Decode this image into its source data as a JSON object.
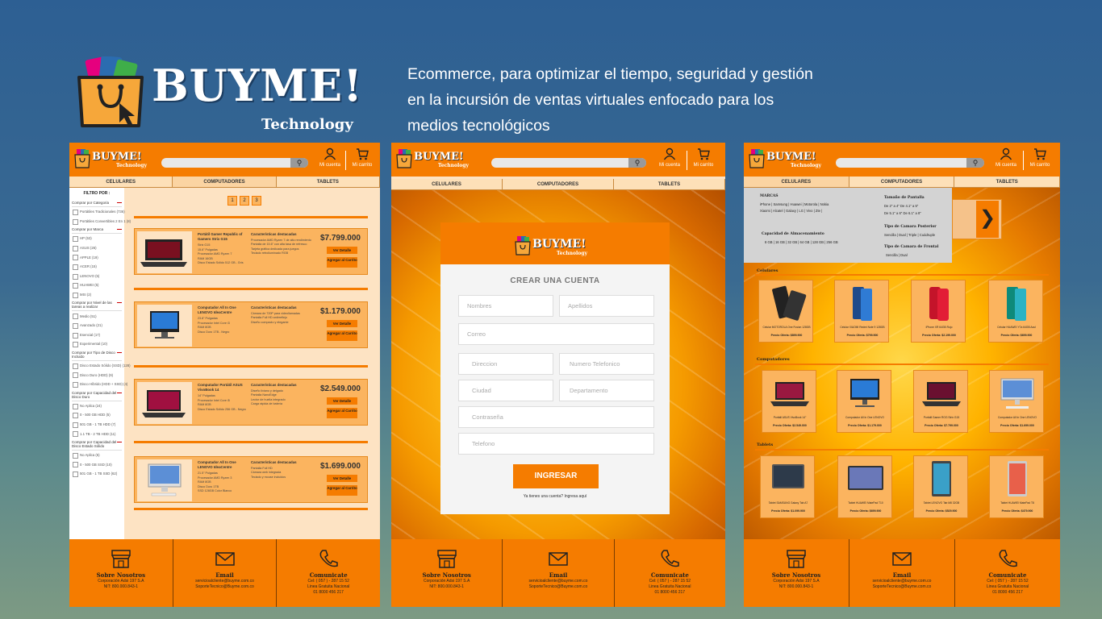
{
  "brand": {
    "title": "BUYME!",
    "subtitle": "Technology",
    "tagline": [
      "Ecommerce, para optimizar el tiempo, seguridad y gestión",
      "en la incursión de ventas virtuales enfocado para los",
      "medios tecnológicos"
    ]
  },
  "header": {
    "logo": "BUYME!",
    "logo_sub": "Technology",
    "account": "Mi cuenta",
    "cart": "Mi carrito"
  },
  "tabs": [
    "CELULARES",
    "COMPUTADORES",
    "TABLETS"
  ],
  "footer": {
    "about": {
      "title": "Sobre Nosotros",
      "lines": [
        "Corporación Adsi 197 S.A",
        "NIT: 800.000.843-1"
      ]
    },
    "email": {
      "title": "Email",
      "lines": [
        "servicioalcliente@buyme.com.co",
        "SoporteTecnico@Buyme.com.co"
      ]
    },
    "contact": {
      "title": "Comunicate",
      "lines": [
        "Cel: ( 057 ) - 287 15 52",
        "Linea Gratuita Nacional",
        "01 8000 456 217"
      ]
    }
  },
  "panel1": {
    "filter_title": "FILTRO POR :",
    "filters": [
      {
        "group": "Comprar por Categoria",
        "options": [
          "Portátiles Tradicionales (736)",
          "Portátiles Convertibles 2 En 1 (8)"
        ]
      },
      {
        "group": "Comprar por Marca",
        "options": [
          "HP (53)",
          "ASUS (26)",
          "APPLE (19)",
          "ACER (15)",
          "LENOVO (5)",
          "HUAWEI (5)",
          "MSI (2)"
        ]
      },
      {
        "group": "Comprar por Nivel de las tareas a realizar",
        "options": [
          "Medio (51)",
          "Avanzado (21)",
          "Esencial (17)",
          "Experimental (10)"
        ]
      },
      {
        "group": "Comprar por Tipo de Disco Incluido",
        "options": [
          "Disco Estado Sólido (SSD) (128)",
          "Disco Duro (HDD) (9)",
          "Disco Híbrido (HDD + SSD) (4)"
        ]
      },
      {
        "group": "Comprar por Capacidad del Disco Duro",
        "options": [
          "No Aplica (24)",
          "0 - 500 GB HDD (5)",
          "501 GB - 1 TB HDD (7)",
          "1.1 TB - 2 TB HDD (11)"
        ]
      },
      {
        "group": "Comprar por Capacidad del Disco Estado Sólido",
        "options": [
          "No Aplica (5)",
          "0 - 500 GB SSD (10)",
          "501 GB - 1 TB SSD (62)"
        ]
      }
    ],
    "pages": [
      "1",
      "2",
      "3"
    ],
    "products": [
      {
        "name": "Portátil Gamer Republic of Gamers Strix G15",
        "specs": [
          "Computador Portátil ROG",
          "Strix G15",
          "15.6\" Pulgadas",
          "Procesador AMD Ryzen 7",
          "RAM 16GB",
          "Disco Estado Sólido 512 GB - Gris"
        ],
        "chars_title": "Características destacadas",
        "chars": [
          "Procesador AMD Ryzen 7 de alto rendimiento",
          "Pantalla de 15.6\" con alta tasa de refresco",
          "Tarjeta gráfica dedicada para juegos",
          "Teclado retroiluminado RGB"
        ],
        "price": "$7.799.000",
        "btn_detail": "Ver Detalle",
        "btn_cart": "Agregar al Carrito"
      },
      {
        "name": "Computador All In One LENOVO IdeaCentre",
        "specs": [
          "Computador All In One",
          "23.8\" Pulgadas",
          "Procesador Intel Core i3",
          "RAM 8GB",
          "Disco Duro 1TB - Negro"
        ],
        "chars_title": "Características destacadas",
        "chars": [
          "Cámara de 720P para videollamadas",
          "Pantalla Full HD antirreflejo",
          "Diseño compacto y elegante"
        ],
        "price": "$1.179.000",
        "btn_detail": "Ver Detalle",
        "btn_cart": "Agregar al Carrito"
      },
      {
        "name": "Computador Portátil ASUS VivoBook 14",
        "specs": [
          "Computador Portátil",
          "14\" Pulgadas",
          "Procesador Intel Core i5",
          "RAM 8GB",
          "Disco Estado Sólido 256 GB - Negro"
        ],
        "chars_title": "Características destacadas",
        "chars": [
          "Diseño liviano y delgado",
          "Pantalla NanoEdge",
          "Lector de huella integrado",
          "Carga rápida de batería"
        ],
        "price": "$2.549.000",
        "btn_detail": "Ver Detalle",
        "btn_cart": "Agregar al Carrito"
      },
      {
        "name": "Computador All In One LENOVO IdeaCentre",
        "specs": [
          "Computador All In One",
          "21.5\" Pulgadas",
          "Procesador AMD Ryzen 3",
          "RAM 8GB",
          "Disco Duro 1TB",
          "SSD 128GB Color Blanco"
        ],
        "chars_title": "Características destacadas",
        "chars": [
          "Pantalla Full HD",
          "Cámara web integrada",
          "Teclado y mouse incluidos"
        ],
        "price": "$1.699.000",
        "btn_detail": "Ver Detalle",
        "btn_cart": "Agregar al Carrito"
      }
    ]
  },
  "panel2": {
    "card_title": "CREAR UNA CUENTA",
    "fields": {
      "nombres": "Nombres",
      "apellidos": "Apellidos",
      "correo": "Correo",
      "direccion": "Direccion",
      "telefono_num": "Numero Telefonico",
      "ciudad": "Ciudad",
      "departamento": "Departamento",
      "contrasena": "Contraseña",
      "telefono": "Telefono"
    },
    "submit": "INGRESAR",
    "login_link": "Ya tienes una cuenta? Ingresa aquí"
  },
  "panel3": {
    "menu": {
      "marcas_title": "MARCAS",
      "marcas_line1": "iPhone | Samsung | Huawei | Motorola | Nokia",
      "marcas_line2": "Xiaomi | Alcatel | Galaxy | LG | Vivo | Zte |",
      "almac_title": "Capacidad de Almacenamiento",
      "almac_line": "8 GB | 16 GB | 32 GB | 64 GB | 128 GB | 256 GB",
      "pantalla_title": "Tamaño de Pantalla",
      "pantalla_line1": "De 2\" a 4\"   De 4.1\" a 5\"",
      "pantalla_line2": "De 5.1\" a 6\"   De 6.1\" a 8\"",
      "camara_post_title": "Tipo de Camara Posterior",
      "camara_post_line": "Sencilla | Dual | Triple | Cuádruple",
      "camara_front_title": "Tipo de Camara de Frontal",
      "camara_front_line": "Sencilla | Dual"
    },
    "categories": [
      "Celulares",
      "Computadores",
      "Tablets"
    ],
    "celulares": [
      {
        "name": "Celular MOTOROLA One Fusion 128GB",
        "price": "Precio Oferta: $899.900"
      },
      {
        "name": "Celular XIAOMI Redmi Note 9 128GB",
        "price": "Precio Oferta: $799.900"
      },
      {
        "name": "iPhone XR 64GB Rojo",
        "price": "Precio Oferta: $2.199.000"
      },
      {
        "name": "Celular HUAWEI Y7a 64GB Azul",
        "price": "Precio Oferta: $699.900"
      }
    ],
    "computadores": [
      {
        "name": "Portátil ASUS VivoBook 14\"",
        "price": "Precio Oferta: $2.549.000"
      },
      {
        "name": "Computador All In One LENOVO",
        "price": "Precio Oferta: $1.179.000"
      },
      {
        "name": "Portátil Gamer ROG Strix G15",
        "price": "Precio Oferta: $7.799.000"
      },
      {
        "name": "Computador All In One LENOVO",
        "price": "Precio Oferta: $1.699.000"
      }
    ],
    "tablets": [
      {
        "name": "Tablet SAMSUNG Galaxy Tab A7",
        "price": "Precio Oferta: $1.099.900"
      },
      {
        "name": "Tablet HUAWEI MatePad T10",
        "price": "Precio Oferta: $699.900"
      },
      {
        "name": "Tablet LENOVO Tab M8 32GB",
        "price": "Precio Oferta: $529.900"
      },
      {
        "name": "Tablet HUAWEI MatePad T8",
        "price": "Precio Oferta: $479.900"
      }
    ]
  }
}
